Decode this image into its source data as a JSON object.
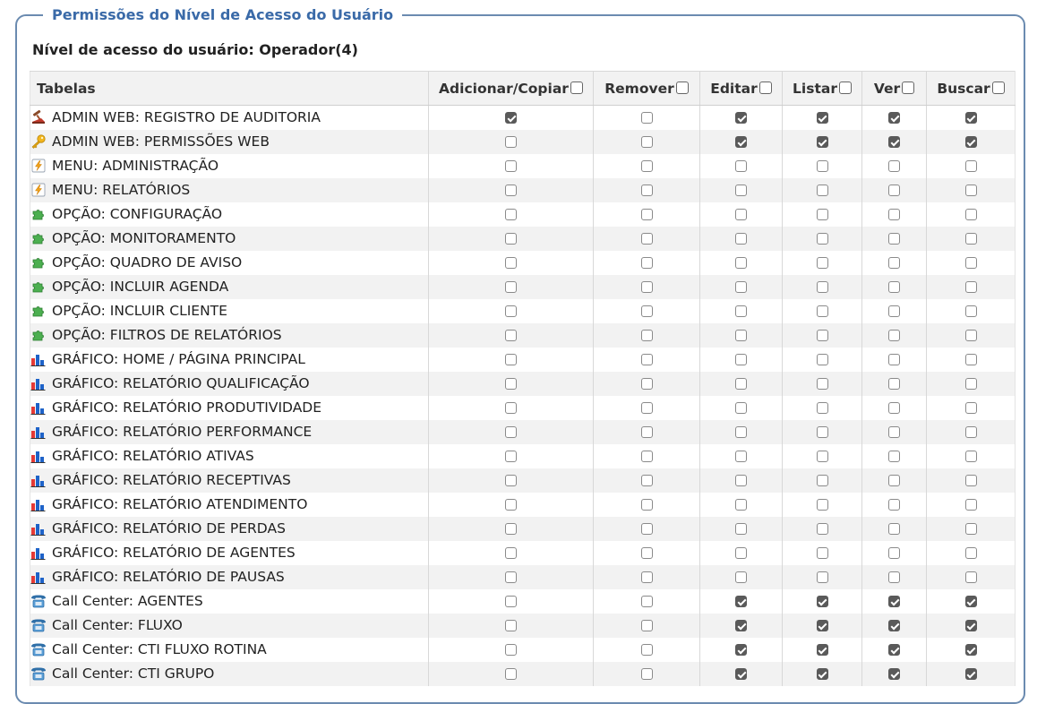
{
  "legend": "Permissões do Nível de Acesso do Usuário",
  "level_label": "Nível de acesso do usuário: Operador(4)",
  "headers": {
    "tables": "Tabelas",
    "cols": [
      "Adicionar/Copiar",
      "Remover",
      "Editar",
      "Listar",
      "Ver",
      "Buscar"
    ]
  },
  "rows": [
    {
      "icon": "auditor-icon",
      "label": "ADMIN WEB: REGISTRO DE AUDITORIA",
      "checks": [
        true,
        false,
        true,
        true,
        true,
        true
      ]
    },
    {
      "icon": "key-icon",
      "label": "ADMIN WEB: PERMISSÕES WEB",
      "checks": [
        false,
        false,
        true,
        true,
        true,
        true
      ]
    },
    {
      "icon": "lightning-page-icon",
      "label": "MENU: ADMINISTRAÇÃO",
      "checks": [
        false,
        false,
        false,
        false,
        false,
        false
      ]
    },
    {
      "icon": "lightning-page-icon",
      "label": "MENU: RELATÓRIOS",
      "checks": [
        false,
        false,
        false,
        false,
        false,
        false
      ]
    },
    {
      "icon": "puzzle-icon",
      "label": "OPÇÃO: CONFIGURAÇÃO",
      "checks": [
        false,
        false,
        false,
        false,
        false,
        false
      ]
    },
    {
      "icon": "puzzle-icon",
      "label": "OPÇÃO: MONITORAMENTO",
      "checks": [
        false,
        false,
        false,
        false,
        false,
        false
      ]
    },
    {
      "icon": "puzzle-icon",
      "label": "OPÇÃO: QUADRO DE AVISO",
      "checks": [
        false,
        false,
        false,
        false,
        false,
        false
      ]
    },
    {
      "icon": "puzzle-icon",
      "label": "OPÇÃO: INCLUIR AGENDA",
      "checks": [
        false,
        false,
        false,
        false,
        false,
        false
      ]
    },
    {
      "icon": "puzzle-icon",
      "label": "OPÇÃO: INCLUIR CLIENTE",
      "checks": [
        false,
        false,
        false,
        false,
        false,
        false
      ]
    },
    {
      "icon": "puzzle-icon",
      "label": "OPÇÃO: FILTROS DE RELATÓRIOS",
      "checks": [
        false,
        false,
        false,
        false,
        false,
        false
      ]
    },
    {
      "icon": "bar-chart-icon",
      "label": "GRÁFICO: HOME / PÁGINA PRINCIPAL",
      "checks": [
        false,
        false,
        false,
        false,
        false,
        false
      ]
    },
    {
      "icon": "bar-chart-icon",
      "label": "GRÁFICO: RELATÓRIO QUALIFICAÇÃO",
      "checks": [
        false,
        false,
        false,
        false,
        false,
        false
      ]
    },
    {
      "icon": "bar-chart-icon",
      "label": "GRÁFICO: RELATÓRIO PRODUTIVIDADE",
      "checks": [
        false,
        false,
        false,
        false,
        false,
        false
      ]
    },
    {
      "icon": "bar-chart-icon",
      "label": "GRÁFICO: RELATÓRIO PERFORMANCE",
      "checks": [
        false,
        false,
        false,
        false,
        false,
        false
      ]
    },
    {
      "icon": "bar-chart-icon",
      "label": "GRÁFICO: RELATÓRIO ATIVAS",
      "checks": [
        false,
        false,
        false,
        false,
        false,
        false
      ]
    },
    {
      "icon": "bar-chart-icon",
      "label": "GRÁFICO: RELATÓRIO RECEPTIVAS",
      "checks": [
        false,
        false,
        false,
        false,
        false,
        false
      ]
    },
    {
      "icon": "bar-chart-icon",
      "label": "GRÁFICO: RELATÓRIO ATENDIMENTO",
      "checks": [
        false,
        false,
        false,
        false,
        false,
        false
      ]
    },
    {
      "icon": "bar-chart-icon",
      "label": "GRÁFICO: RELATÓRIO DE PERDAS",
      "checks": [
        false,
        false,
        false,
        false,
        false,
        false
      ]
    },
    {
      "icon": "bar-chart-icon",
      "label": "GRÁFICO: RELATÓRIO DE AGENTES",
      "checks": [
        false,
        false,
        false,
        false,
        false,
        false
      ]
    },
    {
      "icon": "bar-chart-icon",
      "label": "GRÁFICO: RELATÓRIO DE PAUSAS",
      "checks": [
        false,
        false,
        false,
        false,
        false,
        false
      ]
    },
    {
      "icon": "telephone-icon",
      "label": "Call Center: AGENTES",
      "checks": [
        false,
        false,
        true,
        true,
        true,
        true
      ]
    },
    {
      "icon": "telephone-icon",
      "label": "Call Center: FLUXO",
      "checks": [
        false,
        false,
        true,
        true,
        true,
        true
      ]
    },
    {
      "icon": "telephone-icon",
      "label": "Call Center: CTI FLUXO ROTINA",
      "checks": [
        false,
        false,
        true,
        true,
        true,
        true
      ]
    },
    {
      "icon": "telephone-icon",
      "label": "Call Center: CTI GRUPO",
      "checks": [
        false,
        false,
        true,
        true,
        true,
        true
      ]
    }
  ]
}
